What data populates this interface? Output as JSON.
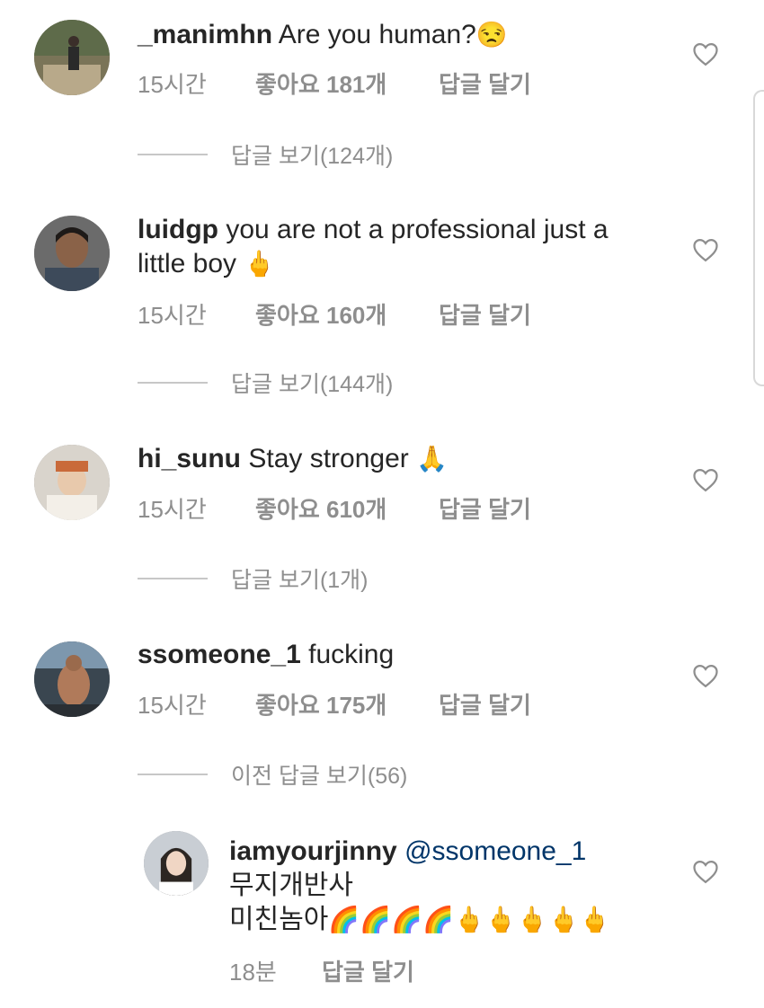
{
  "comments": [
    {
      "username": "_manimhn",
      "text": "Are you human?",
      "emoji": "😒",
      "time": "15시간",
      "likes": "좋아요 181개",
      "reply": "답글 달기",
      "thread": "답글 보기(124개)"
    },
    {
      "username": "luidgp",
      "text": "you are not a professional just a",
      "text2": "little boy",
      "emoji": "🖕",
      "time": "15시간",
      "likes": "좋아요 160개",
      "reply": "답글 달기",
      "thread": "답글 보기(144개)"
    },
    {
      "username": "hi_sunu",
      "text": "Stay stronger",
      "emoji": "🙏",
      "time": "15시간",
      "likes": "좋아요 610개",
      "reply": "답글 달기",
      "thread": "답글 보기(1개)"
    },
    {
      "username": "ssomeone_1",
      "text": "fucking",
      "time": "15시간",
      "likes": "좋아요 175개",
      "reply": "답글 달기",
      "thread": "이전 답글 보기(56)"
    }
  ],
  "reply": {
    "username": "iamyourjinny",
    "mention": "@ssomeone_1",
    "line1": "무지개반사",
    "line2": "미친놈아",
    "emojis": "🌈🌈🌈🌈🖕🖕🖕🖕🖕",
    "time": "18분",
    "reply_label": "답글 달기"
  }
}
